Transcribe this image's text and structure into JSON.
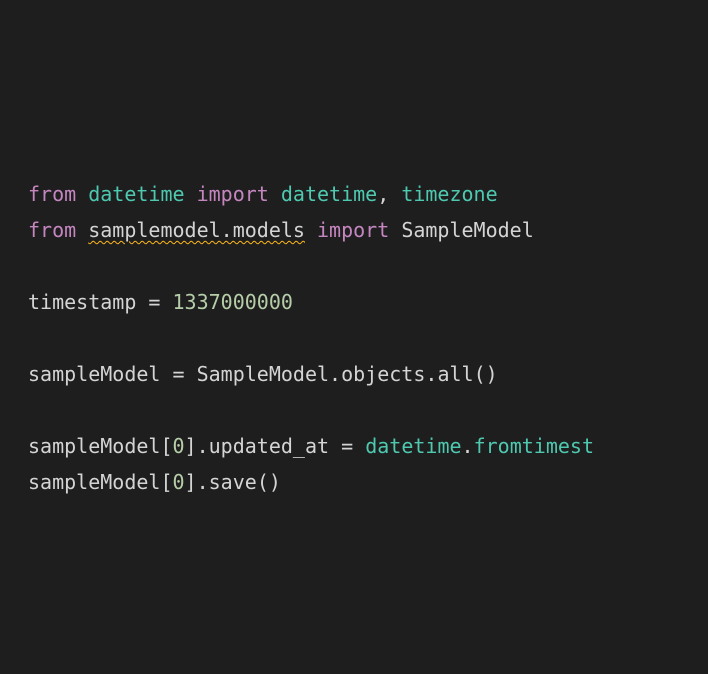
{
  "lines": {
    "line1": {
      "from1": "from",
      "module1": "datetime",
      "import1": "import",
      "name1": "datetime",
      "comma": ",",
      "name2": "timezone"
    },
    "line2": {
      "from2": "from",
      "module2": "samplemodel.models",
      "import2": "import",
      "name3": "SampleModel"
    },
    "line4": {
      "var1": "timestamp",
      "eq1": "=",
      "num1": "1337000000"
    },
    "line6": {
      "var2": "sampleModel",
      "eq2": "=",
      "cls1": "SampleModel",
      "dot1": ".",
      "prop1": "objects",
      "dot2": ".",
      "meth1": "all",
      "paren1": "()"
    },
    "line8": {
      "var3": "sampleModel",
      "bracket1": "[",
      "idx1": "0",
      "bracket2": "]",
      "dot3": ".",
      "prop2": "updated_at",
      "eq3": "=",
      "dt": "datetime",
      "dot4": ".",
      "ft": "fromtimest"
    },
    "line9": {
      "var4": "sampleModel",
      "bracket3": "[",
      "idx2": "0",
      "bracket4": "]",
      "dot5": ".",
      "meth2": "save",
      "paren2": "()"
    }
  }
}
